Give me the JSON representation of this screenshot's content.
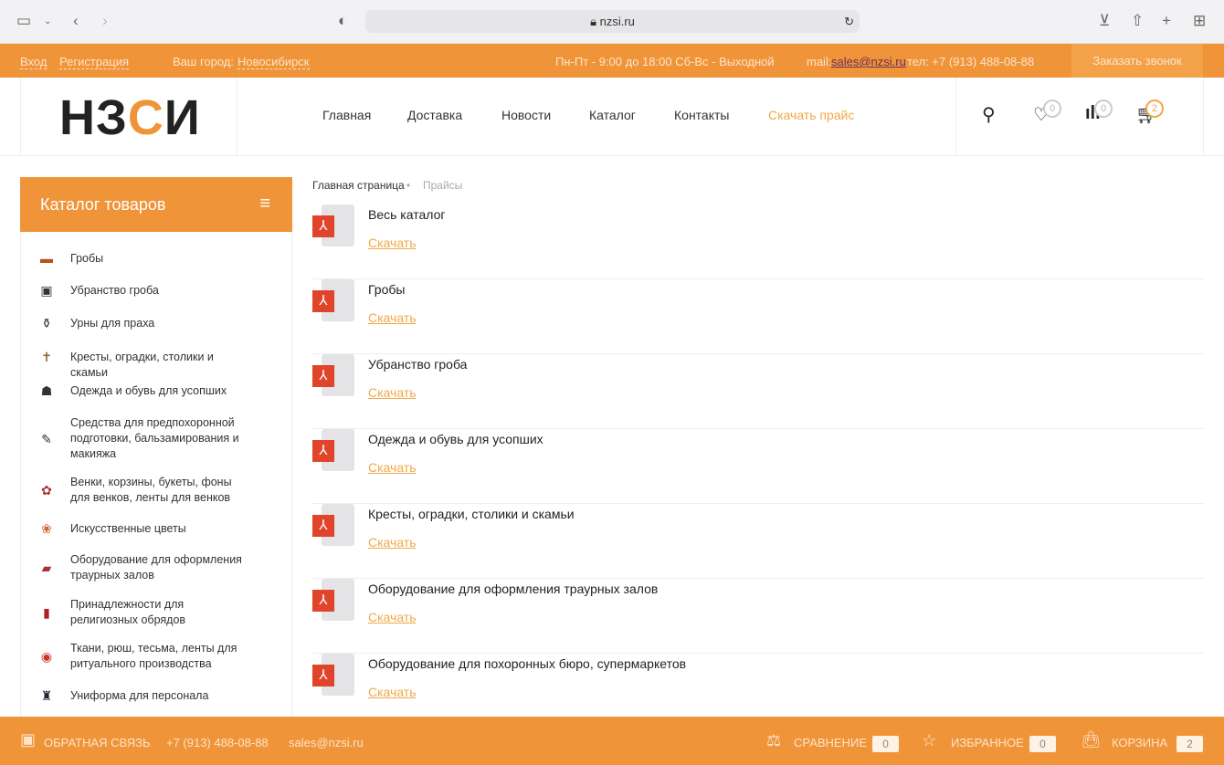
{
  "browser": {
    "url": "nzsi.ru"
  },
  "topbar": {
    "login": "Вход",
    "register": "Регистрация",
    "city_label": "Ваш город:",
    "city": "Новосибирск",
    "hours": "Пн-Пт - 9:00 до 18:00 Сб-Вс - Выходной",
    "mail_label": "mail:",
    "mail": "sales@nzsi.ru",
    "phone": "тел: +7 (913) 488-08-88",
    "callback": "Заказать звонок"
  },
  "header": {
    "logo_a": "НЗ",
    "logo_b": "С",
    "logo_c": "И",
    "nav": [
      "Главная",
      "Доставка",
      "Новости",
      "Каталог",
      "Контакты",
      "Скачать прайс"
    ],
    "favorites_count": "0",
    "compare_count": "0",
    "cart_count": "2"
  },
  "sidebar": {
    "title": "Каталог товаров",
    "items": [
      "Гробы",
      "Убранство гроба",
      "Урны для праха",
      "Кресты, оградки, столики и скамьи",
      "Одежда и обувь для усопших",
      "Средства для предпохоронной подготовки, бальзамирования и макияжа",
      "Венки, корзины, букеты, фоны для венков, ленты для венков",
      "Искусственные цветы",
      "Оборудование для оформления траурных залов",
      "Принадлежности для религиозных обрядов",
      "Ткани, рюш, тесьма, ленты для ритуального производства",
      "Униформа для персонала"
    ]
  },
  "breadcrumb": {
    "home": "Главная страница",
    "current": "Прайсы"
  },
  "prices": {
    "download_label": "Скачать",
    "items": [
      "Весь каталог",
      "Гробы",
      "Убранство гроба",
      "Одежда и обувь для усопших",
      "Кресты, оградки, столики и скамьи",
      "Оборудование для оформления траурных залов",
      "Оборудование для похоронных бюро, супермаркетов"
    ]
  },
  "footer": {
    "feedback": "ОБРАТНАЯ СВЯЗЬ",
    "phone": "+7 (913) 488-08-88",
    "email": "sales@nzsi.ru",
    "compare": "СРАВНЕНИЕ",
    "compare_count": "0",
    "favorites": "ИЗБРАННОЕ",
    "favorites_count": "0",
    "cart": "КОРЗИНА",
    "cart_count": "2"
  }
}
